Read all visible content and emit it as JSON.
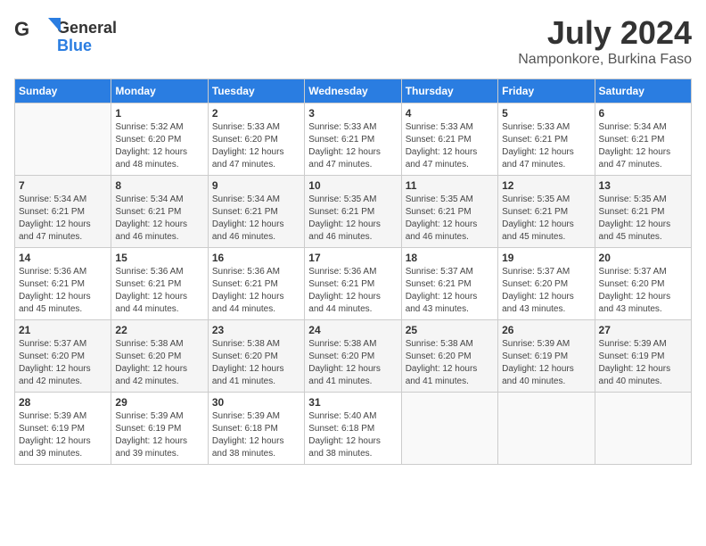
{
  "header": {
    "logo_line1": "General",
    "logo_line2": "Blue",
    "month_year": "July 2024",
    "location": "Namponkore, Burkina Faso"
  },
  "columns": [
    "Sunday",
    "Monday",
    "Tuesday",
    "Wednesday",
    "Thursday",
    "Friday",
    "Saturday"
  ],
  "weeks": [
    [
      {
        "day": "",
        "info": ""
      },
      {
        "day": "1",
        "info": "Sunrise: 5:32 AM\nSunset: 6:20 PM\nDaylight: 12 hours\nand 48 minutes."
      },
      {
        "day": "2",
        "info": "Sunrise: 5:33 AM\nSunset: 6:20 PM\nDaylight: 12 hours\nand 47 minutes."
      },
      {
        "day": "3",
        "info": "Sunrise: 5:33 AM\nSunset: 6:21 PM\nDaylight: 12 hours\nand 47 minutes."
      },
      {
        "day": "4",
        "info": "Sunrise: 5:33 AM\nSunset: 6:21 PM\nDaylight: 12 hours\nand 47 minutes."
      },
      {
        "day": "5",
        "info": "Sunrise: 5:33 AM\nSunset: 6:21 PM\nDaylight: 12 hours\nand 47 minutes."
      },
      {
        "day": "6",
        "info": "Sunrise: 5:34 AM\nSunset: 6:21 PM\nDaylight: 12 hours\nand 47 minutes."
      }
    ],
    [
      {
        "day": "7",
        "info": "Sunrise: 5:34 AM\nSunset: 6:21 PM\nDaylight: 12 hours\nand 47 minutes."
      },
      {
        "day": "8",
        "info": "Sunrise: 5:34 AM\nSunset: 6:21 PM\nDaylight: 12 hours\nand 46 minutes."
      },
      {
        "day": "9",
        "info": "Sunrise: 5:34 AM\nSunset: 6:21 PM\nDaylight: 12 hours\nand 46 minutes."
      },
      {
        "day": "10",
        "info": "Sunrise: 5:35 AM\nSunset: 6:21 PM\nDaylight: 12 hours\nand 46 minutes."
      },
      {
        "day": "11",
        "info": "Sunrise: 5:35 AM\nSunset: 6:21 PM\nDaylight: 12 hours\nand 46 minutes."
      },
      {
        "day": "12",
        "info": "Sunrise: 5:35 AM\nSunset: 6:21 PM\nDaylight: 12 hours\nand 45 minutes."
      },
      {
        "day": "13",
        "info": "Sunrise: 5:35 AM\nSunset: 6:21 PM\nDaylight: 12 hours\nand 45 minutes."
      }
    ],
    [
      {
        "day": "14",
        "info": "Sunrise: 5:36 AM\nSunset: 6:21 PM\nDaylight: 12 hours\nand 45 minutes."
      },
      {
        "day": "15",
        "info": "Sunrise: 5:36 AM\nSunset: 6:21 PM\nDaylight: 12 hours\nand 44 minutes."
      },
      {
        "day": "16",
        "info": "Sunrise: 5:36 AM\nSunset: 6:21 PM\nDaylight: 12 hours\nand 44 minutes."
      },
      {
        "day": "17",
        "info": "Sunrise: 5:36 AM\nSunset: 6:21 PM\nDaylight: 12 hours\nand 44 minutes."
      },
      {
        "day": "18",
        "info": "Sunrise: 5:37 AM\nSunset: 6:21 PM\nDaylight: 12 hours\nand 43 minutes."
      },
      {
        "day": "19",
        "info": "Sunrise: 5:37 AM\nSunset: 6:20 PM\nDaylight: 12 hours\nand 43 minutes."
      },
      {
        "day": "20",
        "info": "Sunrise: 5:37 AM\nSunset: 6:20 PM\nDaylight: 12 hours\nand 43 minutes."
      }
    ],
    [
      {
        "day": "21",
        "info": "Sunrise: 5:37 AM\nSunset: 6:20 PM\nDaylight: 12 hours\nand 42 minutes."
      },
      {
        "day": "22",
        "info": "Sunrise: 5:38 AM\nSunset: 6:20 PM\nDaylight: 12 hours\nand 42 minutes."
      },
      {
        "day": "23",
        "info": "Sunrise: 5:38 AM\nSunset: 6:20 PM\nDaylight: 12 hours\nand 41 minutes."
      },
      {
        "day": "24",
        "info": "Sunrise: 5:38 AM\nSunset: 6:20 PM\nDaylight: 12 hours\nand 41 minutes."
      },
      {
        "day": "25",
        "info": "Sunrise: 5:38 AM\nSunset: 6:20 PM\nDaylight: 12 hours\nand 41 minutes."
      },
      {
        "day": "26",
        "info": "Sunrise: 5:39 AM\nSunset: 6:19 PM\nDaylight: 12 hours\nand 40 minutes."
      },
      {
        "day": "27",
        "info": "Sunrise: 5:39 AM\nSunset: 6:19 PM\nDaylight: 12 hours\nand 40 minutes."
      }
    ],
    [
      {
        "day": "28",
        "info": "Sunrise: 5:39 AM\nSunset: 6:19 PM\nDaylight: 12 hours\nand 39 minutes."
      },
      {
        "day": "29",
        "info": "Sunrise: 5:39 AM\nSunset: 6:19 PM\nDaylight: 12 hours\nand 39 minutes."
      },
      {
        "day": "30",
        "info": "Sunrise: 5:39 AM\nSunset: 6:18 PM\nDaylight: 12 hours\nand 38 minutes."
      },
      {
        "day": "31",
        "info": "Sunrise: 5:40 AM\nSunset: 6:18 PM\nDaylight: 12 hours\nand 38 minutes."
      },
      {
        "day": "",
        "info": ""
      },
      {
        "day": "",
        "info": ""
      },
      {
        "day": "",
        "info": ""
      }
    ]
  ]
}
